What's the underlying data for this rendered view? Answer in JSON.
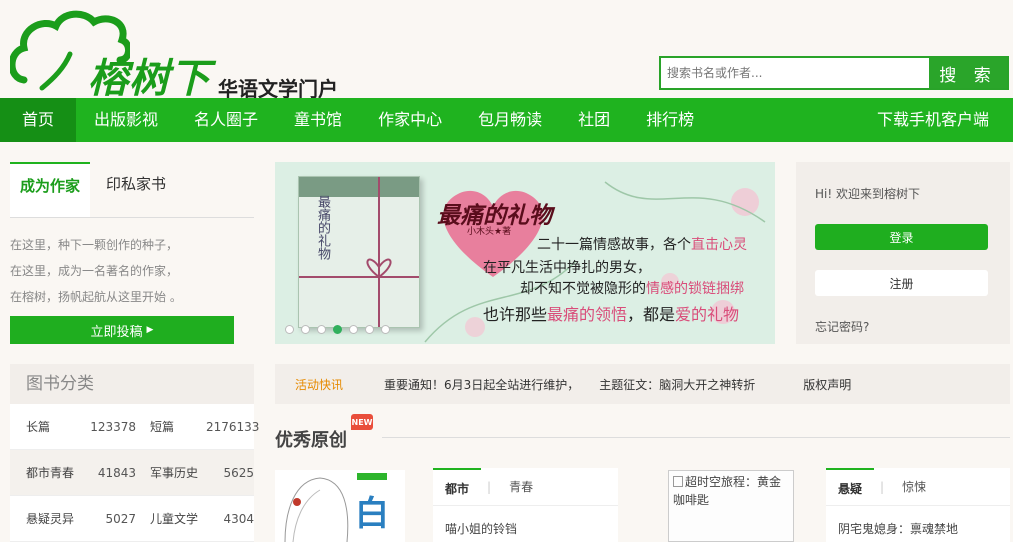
{
  "header": {
    "logo_name": "榕树下",
    "logo_sub": "华语文学门户",
    "search_placeholder": "搜索书名或作者...",
    "search_button": "搜 索"
  },
  "nav": {
    "items": [
      {
        "label": "首页",
        "active": true
      },
      {
        "label": "出版影视"
      },
      {
        "label": "名人圈子"
      },
      {
        "label": "童书馆"
      },
      {
        "label": "作家中心"
      },
      {
        "label": "包月畅读"
      },
      {
        "label": "社团"
      },
      {
        "label": "排行榜"
      }
    ],
    "right": "下载手机客户端"
  },
  "left": {
    "tabs": [
      "成为作家",
      "印私家书"
    ],
    "intro": [
      "在这里，种下一颗创作的种子，",
      "在这里，成为一名著名的作家，",
      "在榕树，扬帆起航从这里开始 。"
    ],
    "submit": "立即投稿"
  },
  "categories": {
    "title": "图书分类",
    "rows": [
      {
        "n1": "长篇",
        "v1": "123378",
        "n2": "短篇",
        "v2": "2176133"
      },
      {
        "n1": "都市青春",
        "v1": "41843",
        "n2": "军事历史",
        "v2": "5625"
      },
      {
        "n1": "悬疑灵异",
        "v1": "5027",
        "n2": "儿童文学",
        "v2": "4304"
      }
    ]
  },
  "banner": {
    "title": "最痛的礼物",
    "author": "小木头★著",
    "book_title": "最痛的礼物",
    "lines": [
      {
        "a": "二十一篇情感故事，各个",
        "hl": "直击心灵",
        "b": ""
      },
      {
        "a": "在平凡生活中挣扎的男女，",
        "hl": "",
        "b": ""
      },
      {
        "a": "却不知不觉被隐形的",
        "hl": "情感的锁链捆绑",
        "b": ""
      },
      {
        "a": "也许那些",
        "hl": "最痛的领悟",
        "b": "，都是",
        "hl2": "爱的礼物"
      }
    ],
    "dots": 7,
    "active_dot": 3
  },
  "login": {
    "welcome": "Hi! 欢迎来到榕树下",
    "login": "登录",
    "register": "注册",
    "forgot": "忘记密码?"
  },
  "news": {
    "label": "活动快讯",
    "items": [
      "重要通知！6月3日起全站进行维护，",
      "主题征文：脑洞大开之神转折",
      "版权声明"
    ]
  },
  "recommend": {
    "title": "优秀原创",
    "badge": "NEW",
    "cover_char": "白",
    "card1": {
      "tab_active": "都市",
      "tab_other": "青春",
      "line": "喵小姐的铃铛"
    },
    "broken_alt": "超时空旅程：黄金咖啡匙",
    "card2": {
      "tab_active": "悬疑",
      "tab_other": "惊悚",
      "line": "阴宅鬼媳身：禀魂禁地"
    }
  },
  "colors": {
    "brand_green": "#1fb31f",
    "accent_pink": "#d94d7a",
    "news_orange": "#e68a00"
  }
}
